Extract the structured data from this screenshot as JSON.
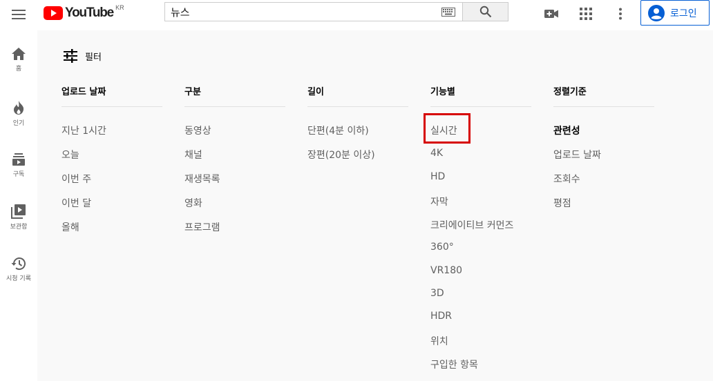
{
  "header": {
    "logo_text": "YouTube",
    "logo_region": "KR",
    "search_value": "뉴스",
    "signin_label": "로그인",
    "icons": [
      "menu-icon",
      "youtube-logo-icon",
      "keyboard-icon",
      "search-icon",
      "video-camera-icon",
      "apps-grid-icon",
      "more-vert-icon",
      "account-circle-icon"
    ],
    "brand_red": "#ff0000",
    "signin_blue": "#065fd4"
  },
  "sidebar": {
    "items": [
      {
        "label": "홈",
        "icon": "home-icon"
      },
      {
        "label": "인기",
        "icon": "fire-icon"
      },
      {
        "label": "구독",
        "icon": "subscriptions-icon"
      },
      {
        "label": "보관함",
        "icon": "library-icon"
      },
      {
        "label": "시청 기록",
        "icon": "history-icon"
      }
    ]
  },
  "filter": {
    "title": "필터",
    "icon": "tune-icon",
    "columns": [
      {
        "title": "업로드 날짜",
        "options": [
          "지난 1시간",
          "오늘",
          "이번 주",
          "이번 달",
          "올해"
        ]
      },
      {
        "title": "구분",
        "options": [
          "동영상",
          "채널",
          "재생목록",
          "영화",
          "프로그램"
        ]
      },
      {
        "title": "길이",
        "options": [
          "단편(4분 이하)",
          "장편(20분 이상)"
        ]
      },
      {
        "title": "기능별",
        "options": [
          "실시간",
          "4K",
          "HD",
          "자막",
          "크리에이티브 커먼즈",
          "360°",
          "VR180",
          "3D",
          "HDR",
          "위치",
          "구입한 항목"
        ]
      },
      {
        "title": "정렬기준",
        "options": [
          "관련성",
          "업로드 날짜",
          "조회수",
          "평점"
        ],
        "selected": "관련성"
      }
    ],
    "highlighted_option": "실시간",
    "highlight_color": "#d60000"
  }
}
